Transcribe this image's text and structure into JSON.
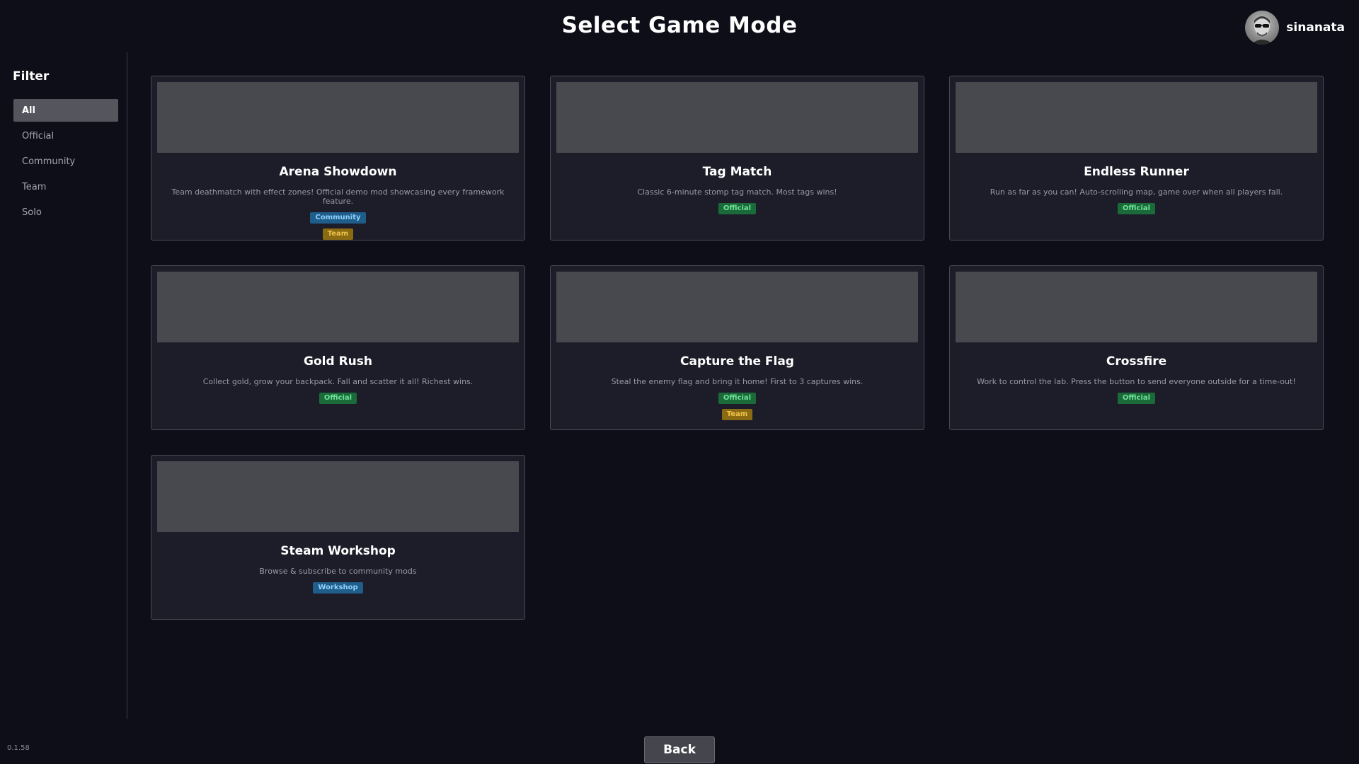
{
  "header": {
    "title": "Select Game Mode",
    "username": "sinanata"
  },
  "sidebar": {
    "heading": "Filter",
    "items": [
      {
        "label": "All",
        "active": true
      },
      {
        "label": "Official",
        "active": false
      },
      {
        "label": "Community",
        "active": false
      },
      {
        "label": "Team",
        "active": false
      },
      {
        "label": "Solo",
        "active": false
      }
    ]
  },
  "modes": [
    {
      "title": "Arena Showdown",
      "description": "Team deathmatch with effect zones! Official demo mod showcasing every framework feature.",
      "tags": [
        {
          "label": "Community",
          "kind": "community"
        },
        {
          "label": "Team",
          "kind": "team"
        }
      ]
    },
    {
      "title": "Tag Match",
      "description": "Classic 6-minute stomp tag match. Most tags wins!",
      "tags": [
        {
          "label": "Official",
          "kind": "official"
        }
      ]
    },
    {
      "title": "Endless Runner",
      "description": "Run as far as you can! Auto-scrolling map, game over when all players fall.",
      "tags": [
        {
          "label": "Official",
          "kind": "official"
        }
      ]
    },
    {
      "title": "Gold Rush",
      "description": "Collect gold, grow your backpack. Fall and scatter it all! Richest wins.",
      "tags": [
        {
          "label": "Official",
          "kind": "official"
        }
      ]
    },
    {
      "title": "Capture the Flag",
      "description": "Steal the enemy flag and bring it home! First to 3 captures wins.",
      "tags": [
        {
          "label": "Official",
          "kind": "official"
        },
        {
          "label": "Team",
          "kind": "team"
        }
      ]
    },
    {
      "title": "Crossfire",
      "description": "Work to control the lab. Press the button to send everyone outside for a time-out!",
      "tags": [
        {
          "label": "Official",
          "kind": "official"
        }
      ]
    },
    {
      "title": "Steam Workshop",
      "description": "Browse & subscribe to community mods",
      "tags": [
        {
          "label": "Workshop",
          "kind": "workshop"
        }
      ]
    }
  ],
  "footer": {
    "version": "0.1.58",
    "back_label": "Back"
  },
  "colors": {
    "background": "#0e0e18",
    "card": "#1d1d29",
    "official_badge": "#1b6a3a",
    "community_badge": "#1f5d8a",
    "team_badge": "#8a6a12"
  }
}
